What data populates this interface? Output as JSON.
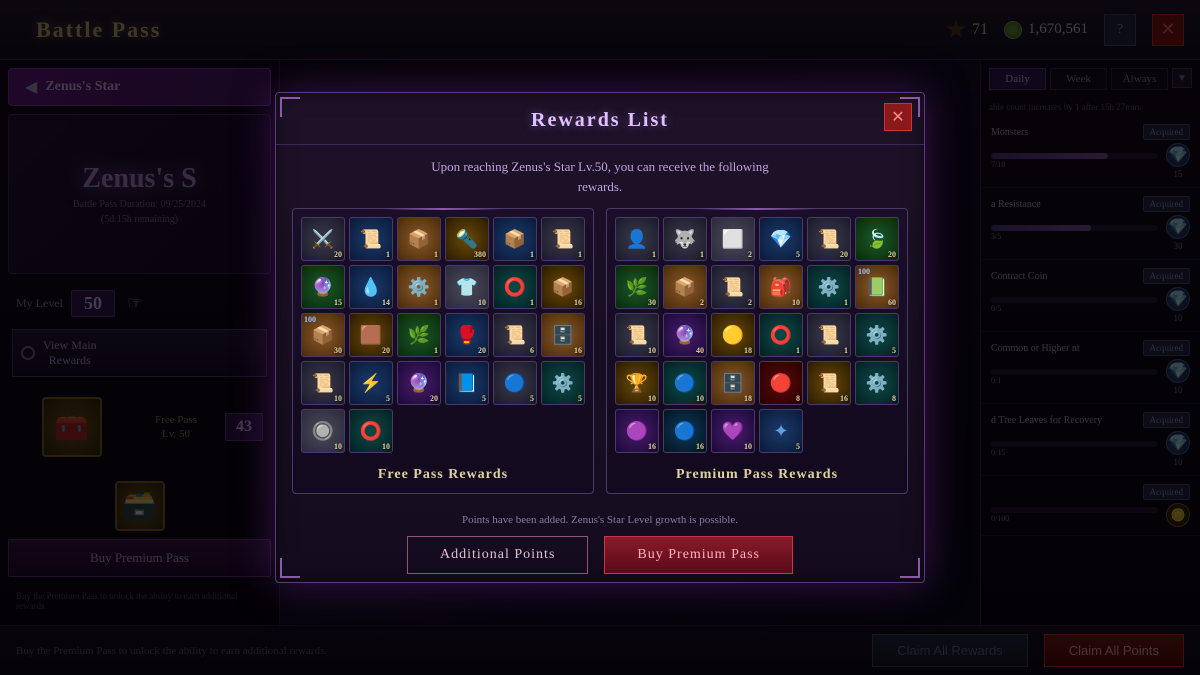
{
  "app": {
    "title": "Battle Pass",
    "zenus_tab": "Zenus's Star",
    "my_level_label": "My Level",
    "my_level": "50",
    "currency_amount": "71",
    "gold_amount": "1,670,561",
    "view_main_rewards": "View Main\nRewards",
    "free_pass_label": "Free Pass",
    "free_pass_lv": "Lv. 50",
    "free_pass_level_num": "43",
    "buy_premium_pass": "Buy Premium Pass",
    "battle_pass_duration": "Battle Pass Duration: 09/25/2024",
    "battle_pass_remaining": "(5d 15h remaining)"
  },
  "modal": {
    "title": "Rewards List",
    "description": "Upon reaching Zenus's Star Lv.50, you can receive the following\nrewards.",
    "free_pass_label": "Free Pass Rewards",
    "premium_pass_label": "Premium Pass Rewards",
    "footer_msg": "Points have been added. Zenus's Star Level growth is possible.",
    "btn_additional": "Additional Points",
    "btn_premium": "Buy Premium Pass"
  },
  "right_sidebar": {
    "tabs": [
      "Daily",
      "Week",
      "Always"
    ],
    "active_tab": "Daily",
    "note": "able count increases by 1 after 15h 27min.",
    "quests": [
      {
        "title": "Monsters",
        "progress": "7/10",
        "fill": 70,
        "points": 15,
        "status": "Acquired"
      },
      {
        "title": "a Resistance",
        "progress": "3/5",
        "fill": 60,
        "points": 30,
        "status": "Acquired"
      },
      {
        "title": "Contract Coin",
        "progress": "0/5",
        "fill": 0,
        "points": 10,
        "status": "Acquired"
      },
      {
        "title": "Common or Higher nt",
        "progress": "0/1",
        "fill": 0,
        "points": 10,
        "status": "Acquired"
      },
      {
        "title": "d Tree Leaves for Recovery",
        "progress": "0/15",
        "fill": 0,
        "points": 10,
        "status": "Acquired"
      },
      {
        "title": "",
        "progress": "0/100",
        "fill": 0,
        "points": null,
        "status": "Acquired"
      }
    ]
  },
  "bottom_bar": {
    "info": "Buy the Premium Pass to unlock the ability to earn additional rewards.",
    "claim_rewards": "Claim All Rewards",
    "claim_points": "Claim All Points"
  }
}
